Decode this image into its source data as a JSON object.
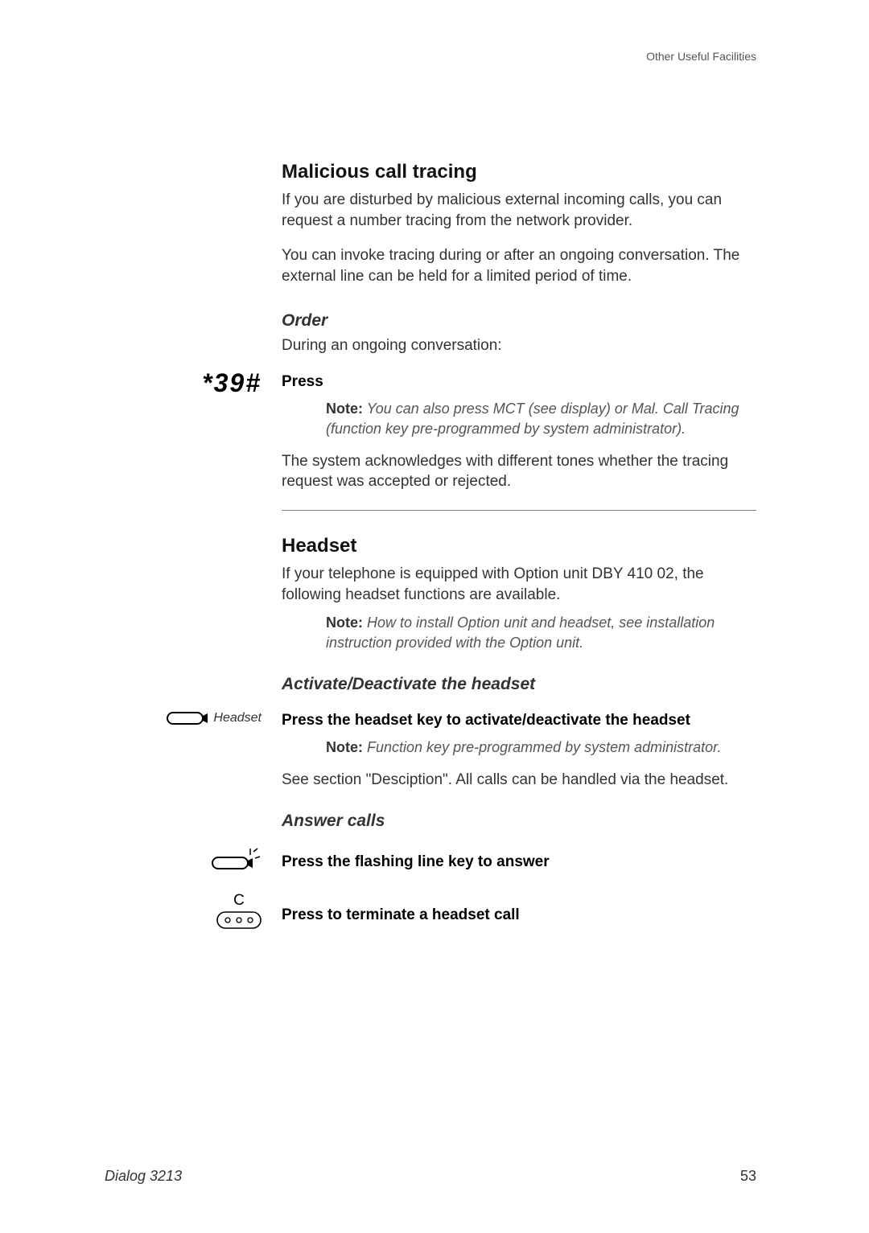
{
  "header": {
    "chapter": "Other Useful Facilities"
  },
  "section1": {
    "title": "Malicious call tracing",
    "p1": "If you are disturbed by malicious external incoming calls, you can request a number tracing from the network provider.",
    "p2": "You can invoke tracing during or after an ongoing conversation. The external line can be held for a limited period of time.",
    "order_heading": "Order",
    "order_intro": "During an ongoing conversation:",
    "key_code": "*39#",
    "press_label": "Press",
    "note_label": "Note:",
    "note_text": "You can also press MCT (see display) or Mal. Call Tracing (function key pre-programmed by system administrator).",
    "ack_text": "The system acknowledges with different tones whether the tracing request was accepted or rejected."
  },
  "section2": {
    "title": "Headset",
    "p1": "If your telephone is equipped with Option unit DBY 410 02, the following headset functions are available.",
    "note_label": "Note:",
    "note_text": "How to install Option unit and headset, see installation instruction provided with the Option unit.",
    "activate_heading": "Activate/Deactivate the headset",
    "headset_label": "Headset",
    "activate_step": "Press the headset key to activate/deactivate the headset",
    "activate_note_label": "Note:",
    "activate_note_text": "Function key pre-programmed by system administrator.",
    "see_section": "See section \"Desciption\". All calls can be handled via the headset.",
    "answer_heading": "Answer calls",
    "answer_step": "Press the flashing line key to answer",
    "clear_label": "C",
    "terminate_step": "Press to terminate a headset call"
  },
  "footer": {
    "model": "Dialog 3213",
    "page": "53"
  }
}
